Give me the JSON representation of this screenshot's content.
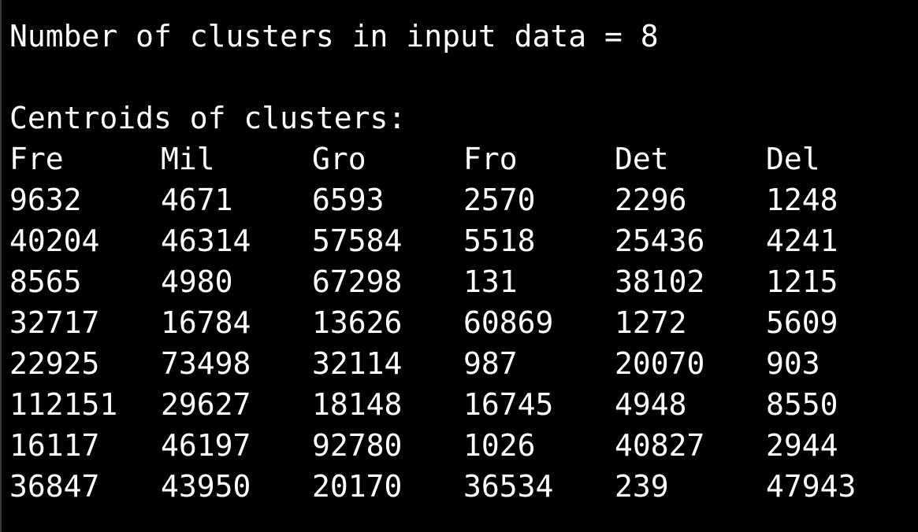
{
  "colors": {
    "background": "#000000",
    "foreground": "#ffffff"
  },
  "header": {
    "cluster_count_line": "Number of clusters in input data = 8",
    "centroids_heading": "Centroids of clusters:"
  },
  "table": {
    "columns": [
      "Fre",
      "Mil",
      "Gro",
      "Fro",
      "Det",
      "Del"
    ],
    "rows": [
      [
        "9632",
        "4671",
        "6593",
        "2570",
        "2296",
        "1248"
      ],
      [
        "40204",
        "46314",
        "57584",
        "5518",
        "25436",
        "4241"
      ],
      [
        "8565",
        "4980",
        "67298",
        "131",
        "38102",
        "1215"
      ],
      [
        "32717",
        "16784",
        "13626",
        "60869",
        "1272",
        "5609"
      ],
      [
        "22925",
        "73498",
        "32114",
        "987",
        "20070",
        "903"
      ],
      [
        "112151",
        "29627",
        "18148",
        "16745",
        "4948",
        "8550"
      ],
      [
        "16117",
        "46197",
        "92780",
        "1026",
        "40827",
        "2944"
      ],
      [
        "36847",
        "43950",
        "20170",
        "36534",
        "239",
        "47943"
      ]
    ]
  }
}
